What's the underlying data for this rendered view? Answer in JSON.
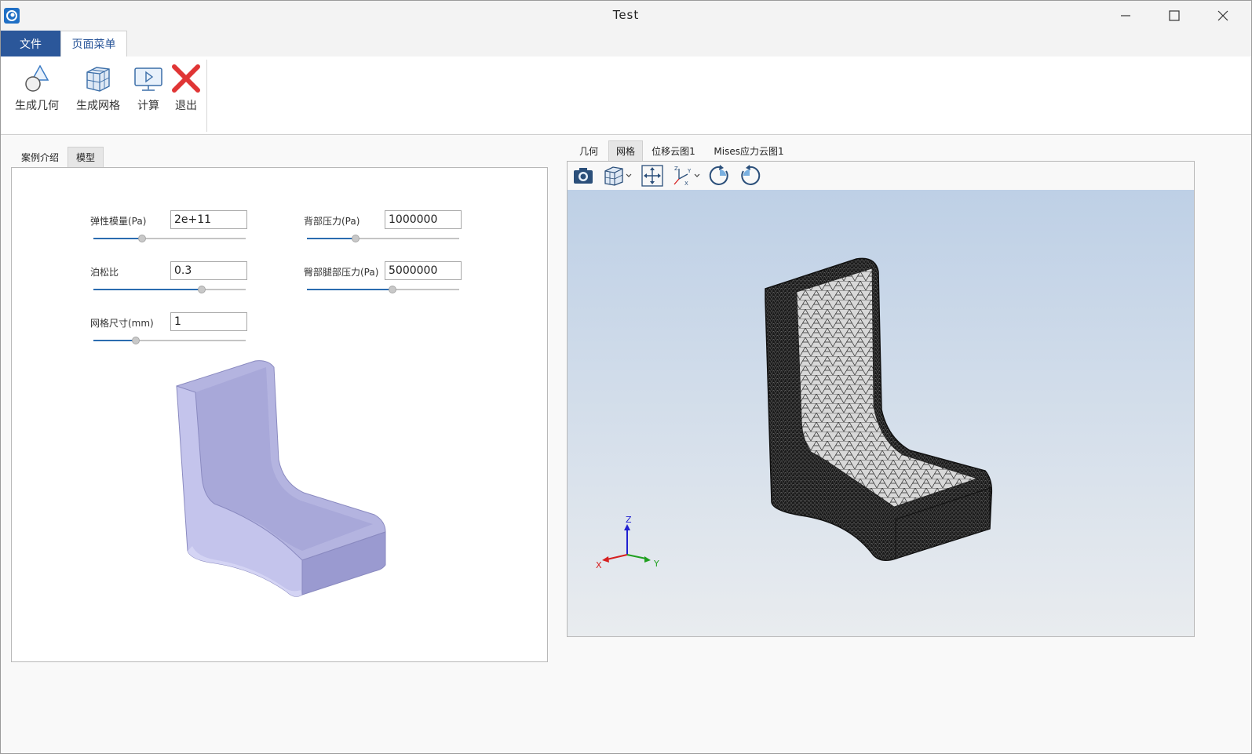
{
  "window": {
    "title": "Test"
  },
  "ribbon": {
    "tabs": [
      {
        "label": "文件",
        "active": false
      },
      {
        "label": "页面菜单",
        "active": true
      }
    ],
    "buttons": [
      {
        "label": "生成几何",
        "icon": "geometry-icon"
      },
      {
        "label": "生成网格",
        "icon": "mesh-cube-icon"
      },
      {
        "label": "计算",
        "icon": "compute-monitor-icon"
      },
      {
        "label": "退出",
        "icon": "exit-x-icon"
      }
    ]
  },
  "left_panel": {
    "tabs": [
      {
        "label": "案例介绍",
        "active": false
      },
      {
        "label": "模型",
        "active": true
      }
    ],
    "params": {
      "elastic_modulus": {
        "label": "弹性模量(Pa)",
        "value": "2e+11",
        "slider": 0.32
      },
      "back_pressure": {
        "label": "背部压力(Pa)",
        "value": "1000000",
        "slider": 0.32
      },
      "poisson_ratio": {
        "label": "泊松比",
        "value": "0.3",
        "slider": 0.71
      },
      "hip_leg_pressure": {
        "label": "臀部腿部压力(Pa)",
        "value": "5000000",
        "slider": 0.56
      },
      "mesh_size": {
        "label": "网格尺寸(mm)",
        "value": "1",
        "slider": 0.28
      }
    },
    "model_color": "#b8b8de"
  },
  "right_panel": {
    "tabs": [
      {
        "label": "几何",
        "active": false
      },
      {
        "label": "网格",
        "active": true
      },
      {
        "label": "位移云图1",
        "active": false
      },
      {
        "label": "Mises应力云图1",
        "active": false
      }
    ],
    "toolbar": [
      {
        "icon": "camera-icon"
      },
      {
        "icon": "view-cube-icon",
        "dropdown": true
      },
      {
        "icon": "fit-view-icon"
      },
      {
        "icon": "axes-view-icon",
        "dropdown": true
      },
      {
        "icon": "rotate-cw-icon"
      },
      {
        "icon": "rotate-ccw-icon"
      }
    ],
    "triad": {
      "x": "X",
      "y": "Y",
      "z": "Z"
    },
    "colors": {
      "x_axis": "#d62020",
      "y_axis": "#20a020",
      "z_axis": "#2020d0",
      "accent": "#2b579a"
    }
  }
}
